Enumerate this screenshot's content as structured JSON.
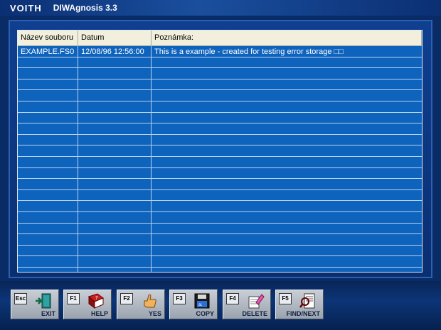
{
  "title": {
    "brand": "VOITH",
    "app": "DIWAgnosis 3.3"
  },
  "table": {
    "columns": [
      "Název souboru",
      "Datum",
      "Poznámka:"
    ],
    "rows": [
      {
        "name": "EXAMPLE.FS0",
        "date": "12/08/96  12:56:00",
        "note": "This is a example - created for testing error storage  □□"
      }
    ]
  },
  "buttons": [
    {
      "key": "Esc",
      "label": "EXIT",
      "icon": "exit-door-icon"
    },
    {
      "key": "F1",
      "label": "HELP",
      "icon": "help-book-icon"
    },
    {
      "key": "F2",
      "label": "YES",
      "icon": "thumbs-up-icon"
    },
    {
      "key": "F3",
      "label": "COPY",
      "icon": "floppy-disk-icon"
    },
    {
      "key": "F4",
      "label": "DELETE",
      "icon": "eraser-icon"
    },
    {
      "key": "F5",
      "label": "FIND/NEXT",
      "icon": "find-document-icon"
    }
  ],
  "colors": {
    "grid_bg": "#0e63bd",
    "header_bg": "#f2f0dc",
    "title_bg": "#0b2f73"
  }
}
